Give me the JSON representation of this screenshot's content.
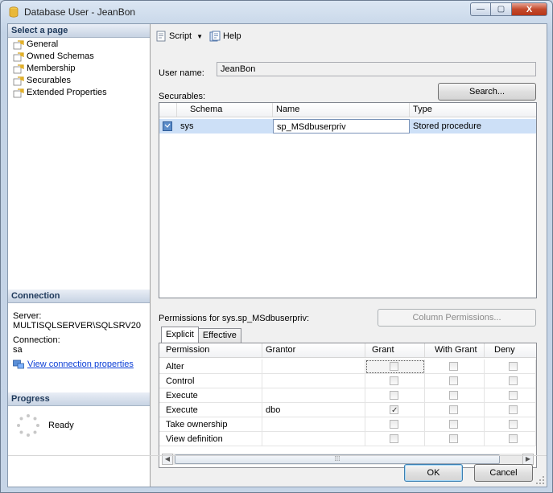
{
  "window": {
    "title": "Database User - JeanBon",
    "min_glyph": "—",
    "max_glyph": "▢",
    "close_glyph": "X"
  },
  "left": {
    "select_page_label": "Select a page",
    "pages": [
      "General",
      "Owned Schemas",
      "Membership",
      "Securables",
      "Extended Properties"
    ],
    "connection_label": "Connection",
    "server_label": "Server:",
    "server_value": "MULTISQLSERVER\\SQLSRV20",
    "connection_field_label": "Connection:",
    "connection_value": "sa",
    "view_connection_link": "View connection properties",
    "progress_label": "Progress",
    "progress_status": "Ready"
  },
  "toolbar": {
    "script_label": "Script",
    "help_label": "Help"
  },
  "user": {
    "label": "User name:",
    "value": "JeanBon"
  },
  "securables": {
    "label": "Securables:",
    "search_button": "Search...",
    "columns": [
      "Schema",
      "Name",
      "Type"
    ],
    "rows": [
      {
        "schema": "sys",
        "name": "sp_MSdbuserpriv",
        "type": "Stored procedure"
      }
    ]
  },
  "permissions": {
    "label": "Permissions for sys.sp_MSdbuserpriv:",
    "column_permissions_button": "Column Permissions...",
    "tabs": [
      "Explicit",
      "Effective"
    ],
    "columns": [
      "Permission",
      "Grantor",
      "Grant",
      "With Grant",
      "Deny"
    ],
    "rows": [
      {
        "permission": "Alter",
        "grantor": "",
        "grant": false,
        "with_grant": false,
        "deny": false
      },
      {
        "permission": "Control",
        "grantor": "",
        "grant": false,
        "with_grant": false,
        "deny": false
      },
      {
        "permission": "Execute",
        "grantor": "",
        "grant": false,
        "with_grant": false,
        "deny": false
      },
      {
        "permission": "Execute",
        "grantor": "dbo",
        "grant": true,
        "with_grant": false,
        "deny": false
      },
      {
        "permission": "Take ownership",
        "grantor": "",
        "grant": false,
        "with_grant": false,
        "deny": false
      },
      {
        "permission": "View definition",
        "grantor": "",
        "grant": false,
        "with_grant": false,
        "deny": false
      }
    ]
  },
  "buttons": {
    "ok": "OK",
    "cancel": "Cancel"
  }
}
